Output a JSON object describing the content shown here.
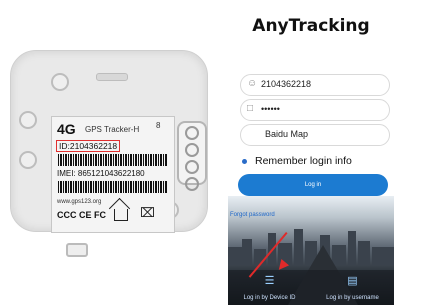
{
  "device_label": {
    "network": "4G",
    "product": "GPS Tracker-H",
    "badge": "8",
    "id_line": "ID:2104362218",
    "imei_line": "IMEI: 865121043622180",
    "website": "www.gps123.org",
    "certs": "CCC CE FC",
    "bin_symbol": "⌧"
  },
  "app": {
    "logo": "AnyTracking",
    "account_value": "2104362218",
    "password_value": "••••••",
    "map_value": "Baidu Map",
    "remember_label": "Remember login info",
    "login_label": "Log in",
    "forgot_label": "Forgot password",
    "tabs": [
      {
        "label": "Log in by Device ID",
        "icon": "list-icon"
      },
      {
        "label": "Log in by username",
        "icon": "id-card-icon"
      }
    ],
    "accent_color": "#1c7bd1",
    "annotation_color": "#e02a2a"
  }
}
